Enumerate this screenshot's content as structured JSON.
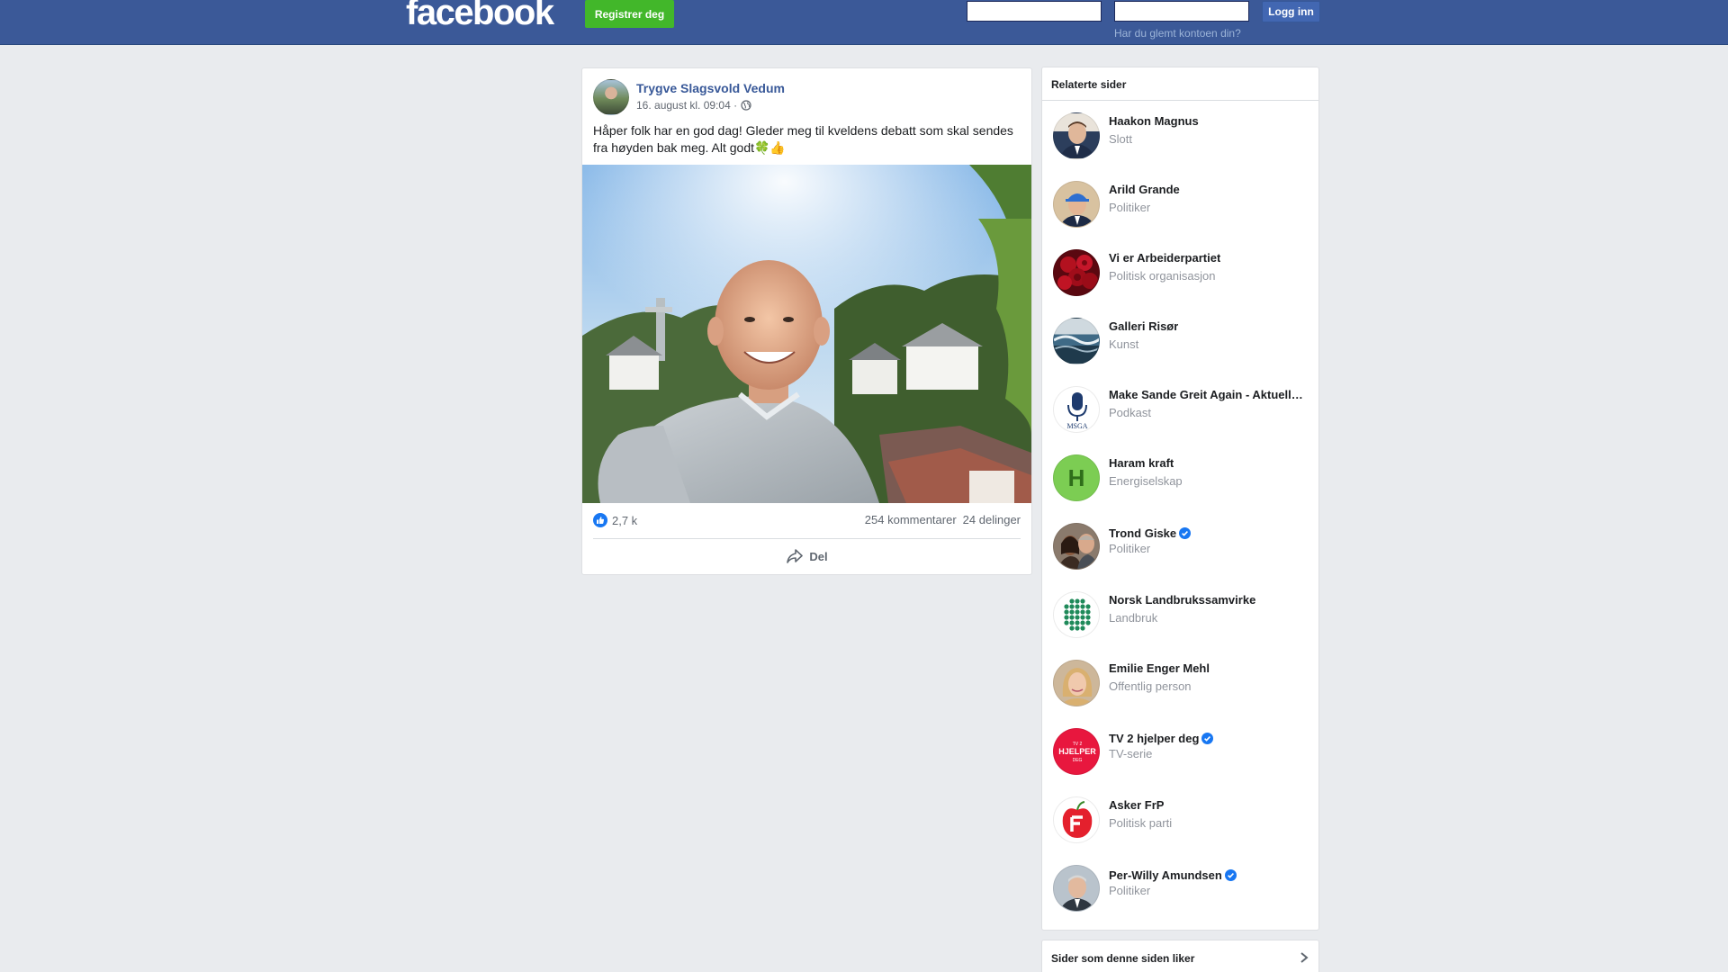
{
  "header": {
    "logo_text": "facebook",
    "register_label": "Registrer deg",
    "email_value": "",
    "password_value": "",
    "login_label": "Logg inn",
    "forgot_label": "Har du glemt kontoen din?"
  },
  "post": {
    "author": "Trygve Slagsvold Vedum",
    "timestamp": "16. august kl. 09:04 ·",
    "text": "Håper folk har en god dag! Gleder meg til kveldens debatt som skal sendes fra høyden bak meg. Alt godt🍀👍",
    "reaction_count": "2,7 k",
    "comments": "254 kommentarer",
    "shares": "24 delinger",
    "share_label": "Del"
  },
  "related": {
    "title": "Relaterte sider",
    "items": [
      {
        "name": "Haakon Magnus",
        "category": "Slott",
        "verified": false,
        "icon": "portrait-avatar",
        "color": "#2c3e5c"
      },
      {
        "name": "Arild Grande",
        "category": "Politiker",
        "verified": false,
        "icon": "portrait-hardhat-avatar",
        "color": "#c7a27c"
      },
      {
        "name": "Vi er Arbeiderpartiet",
        "category": "Politisk organisasjon",
        "verified": false,
        "icon": "red-roses-avatar",
        "color": "#8b0d1a"
      },
      {
        "name": "Galleri Risør",
        "category": "Kunst",
        "verified": false,
        "icon": "wave-painting-avatar",
        "color": "#3f6a86"
      },
      {
        "name": "Make Sande Greit Again - Aktuell…",
        "category": "Podkast",
        "verified": false,
        "icon": "microphone-avatar",
        "color": "#1e3b6e"
      },
      {
        "name": "Haram kraft",
        "category": "Energiselskap",
        "verified": false,
        "icon": "letter-h-avatar",
        "color": "#7ccd53"
      },
      {
        "name": "Trond Giske",
        "category": "Politiker",
        "verified": true,
        "icon": "couple-portrait-avatar",
        "color": "#5a3b2a"
      },
      {
        "name": "Norsk Landbrukssamvirke",
        "category": "Landbruk",
        "verified": false,
        "icon": "green-dots-logo-avatar",
        "color": "#1f8a5a"
      },
      {
        "name": "Emilie Enger Mehl",
        "category": "Offentlig person",
        "verified": false,
        "icon": "portrait-blonde-avatar",
        "color": "#d9b38c"
      },
      {
        "name": "TV 2 hjelper deg",
        "category": "TV-serie",
        "verified": true,
        "icon": "tv2-hjelper-logo-avatar",
        "color": "#e8173e"
      },
      {
        "name": "Asker FrP",
        "category": "Politisk parti",
        "verified": false,
        "icon": "frp-apple-logo-avatar",
        "color": "#e4202d"
      },
      {
        "name": "Per-Willy Amundsen",
        "category": "Politiker",
        "verified": true,
        "icon": "portrait-grey-avatar",
        "color": "#6b7b8a"
      }
    ],
    "tv2_logo_text": "HJELPER",
    "tv2_logo_small_top": "TV 2",
    "tv2_logo_small_bottom": "DEG",
    "haram_letter": "H",
    "msga_text": "MSGA"
  },
  "liked_section": {
    "title": "Sider som denne siden liker"
  },
  "colors": {
    "header_bg": "#3b5998",
    "register_green": "#42b72a",
    "link_blue": "#385898",
    "page_bg": "#e9ebee",
    "verified_blue": "#1877f2"
  }
}
